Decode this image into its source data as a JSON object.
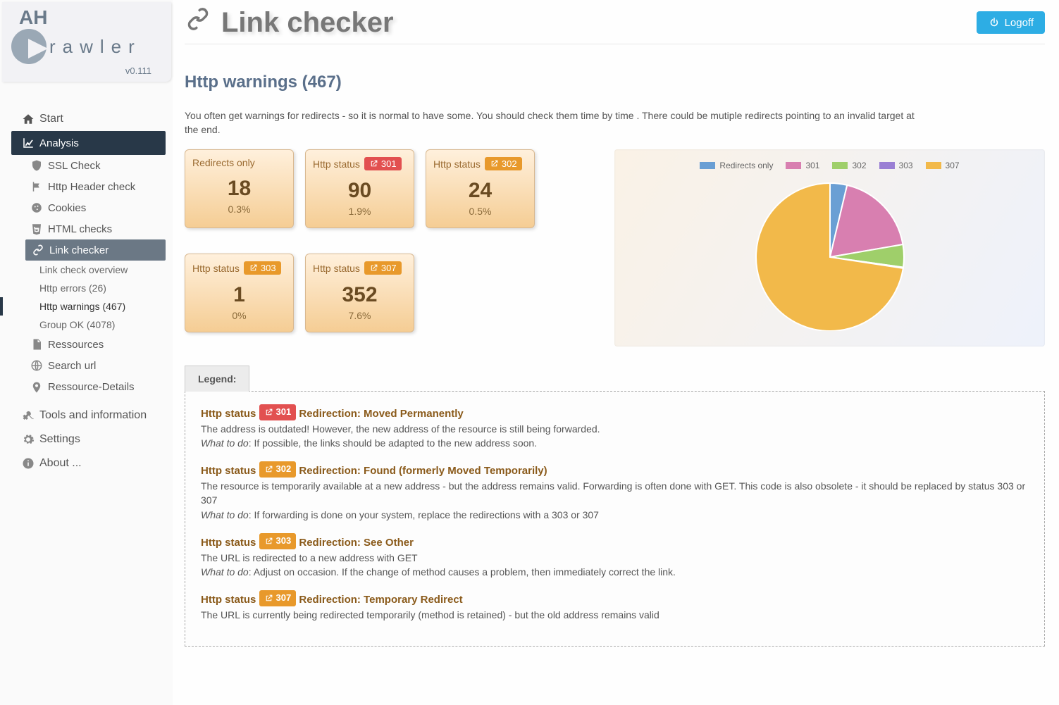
{
  "app": {
    "name_top": "AH",
    "name_rest": "rawler",
    "version": "v0.111"
  },
  "header": {
    "title": "Link checker",
    "logoff": "Logoff"
  },
  "sidebar": {
    "start": "Start",
    "analysis": "Analysis",
    "subs": {
      "ssl": "SSL Check",
      "httpheader": "Http Header check",
      "cookies": "Cookies",
      "htmlchecks": "HTML checks",
      "linkchecker": "Link checker",
      "ressources": "Ressources",
      "searchurl": "Search url",
      "resdetails": "Ressource-Details"
    },
    "link_subs": {
      "overview": "Link check overview",
      "errors": "Http errors (26)",
      "warnings": "Http warnings (467)",
      "groupok": "Group OK (4078)"
    },
    "tools": "Tools and information",
    "settings": "Settings",
    "about": "About ..."
  },
  "section": {
    "title": "Http warnings (467)",
    "desc": "You often get warnings for redirects - so it is normal to have some. You should check them time by time . There could be mutiple redirects pointing to an invalid target at the end."
  },
  "tiles": [
    {
      "label": "Redirects only",
      "badge": "",
      "num": "18",
      "pct": "0.3%"
    },
    {
      "label": "Http status",
      "badge": "301",
      "badgecls": "b301",
      "num": "90",
      "pct": "1.9%"
    },
    {
      "label": "Http status",
      "badge": "302",
      "badgecls": "b302",
      "num": "24",
      "pct": "0.5%"
    },
    {
      "label": "Http status",
      "badge": "303",
      "badgecls": "b303",
      "num": "1",
      "pct": "0%"
    },
    {
      "label": "Http status",
      "badge": "307",
      "badgecls": "b307",
      "num": "352",
      "pct": "7.6%"
    }
  ],
  "chart_data": {
    "type": "pie",
    "title": "",
    "series": [
      {
        "name": "Redirects only",
        "value": 18,
        "color": "#6a9fd4"
      },
      {
        "name": "301",
        "value": 90,
        "color": "#d87fb0"
      },
      {
        "name": "302",
        "value": 24,
        "color": "#9fcf6a"
      },
      {
        "name": "303",
        "value": 1,
        "color": "#9a7fd4"
      },
      {
        "name": "307",
        "value": 352,
        "color": "#f2b94a"
      }
    ]
  },
  "legend": {
    "tab": "Legend:",
    "entries": [
      {
        "code": "301",
        "cls": "b301",
        "title": "Redirection: Moved Permanently",
        "line1": "The address is outdated! However, the new address of the resource is still being forwarded.",
        "what": "What to do",
        "line2": ": If possible, the links should be adapted to the new address soon."
      },
      {
        "code": "302",
        "cls": "b302",
        "title": "Redirection: Found (formerly Moved Temporarily)",
        "line1": "The resource is temporarily available at a new address - but the address remains valid. Forwarding is often done with GET. This code is also obsolete - it should be replaced by status 303 or 307",
        "what": "What to do",
        "line2": ": If forwarding is done on your system, replace the redirections with a 303 or 307"
      },
      {
        "code": "303",
        "cls": "b303",
        "title": "Redirection: See Other",
        "line1": "The URL is redirected to a new address with GET",
        "what": "What to do",
        "line2": ": Adjust on occasion. If the change of method causes a problem, then immediately correct the link."
      },
      {
        "code": "307",
        "cls": "b307",
        "title": "Redirection: Temporary Redirect",
        "line1": "The URL is currently being redirected temporarily (method is retained) - but the old address remains valid",
        "what": "",
        "line2": ""
      }
    ],
    "status_prefix": "Http status"
  }
}
